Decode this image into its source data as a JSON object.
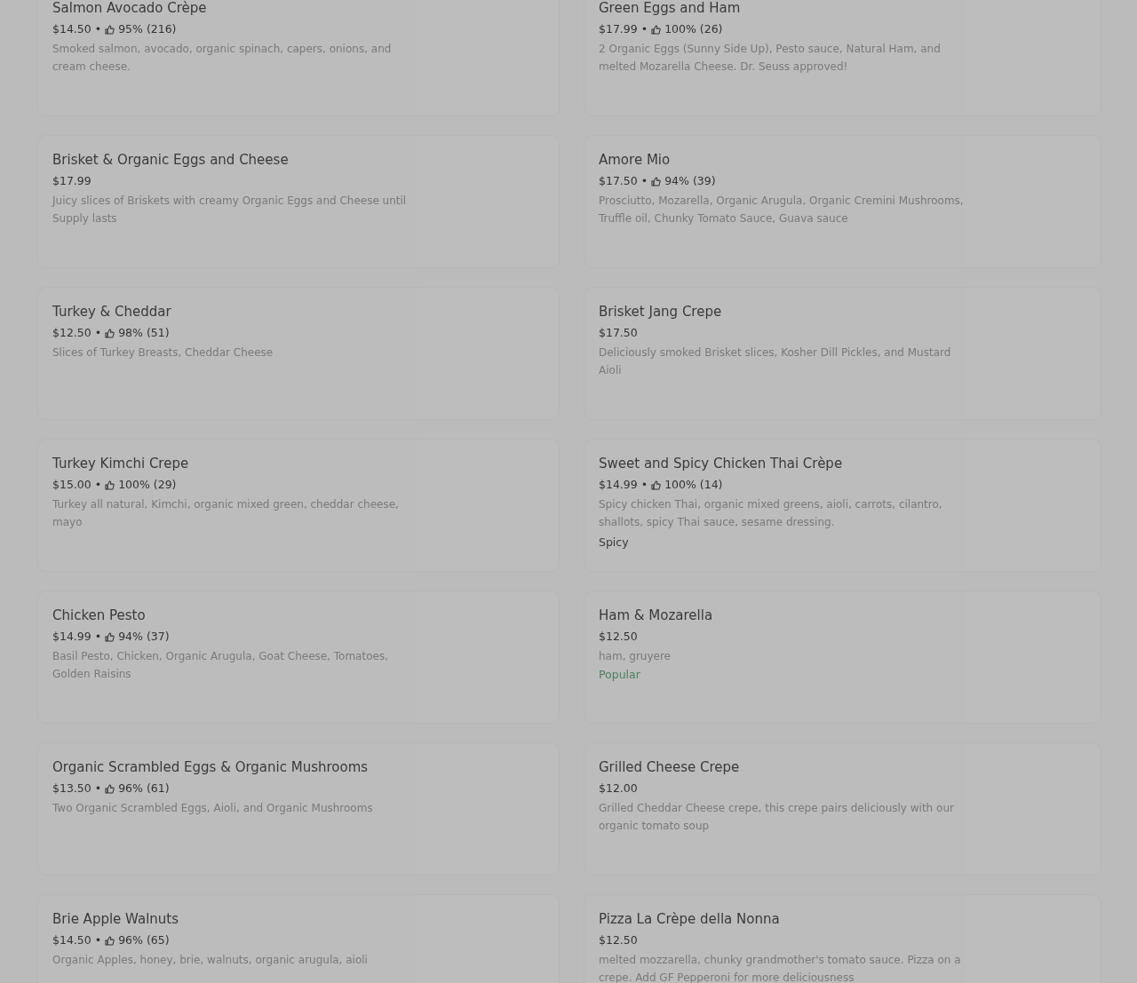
{
  "separator": "•",
  "items": [
    {
      "title": "Salmon Avocado Crèpe",
      "price": "$14.50",
      "rating": "95% (216)",
      "description": "Smoked salmon, avocado, organic spinach, capers, onions, and cream cheese."
    },
    {
      "title": "Green Eggs and Ham",
      "price": "$17.99",
      "rating": "100% (26)",
      "description": "2 Organic Eggs (Sunny Side Up), Pesto sauce, Natural Ham, and melted Mozarella Cheese. Dr. Seuss approved!"
    },
    {
      "title": "Brisket & Organic Eggs and Cheese",
      "price": "$17.99",
      "description": "Juicy slices of Briskets with creamy Organic Eggs and Cheese until Supply lasts"
    },
    {
      "title": "Amore Mio",
      "price": "$17.50",
      "rating": "94% (39)",
      "description": "Prosciutto, Mozarella, Organic Arugula, Organic Cremini Mushrooms, Truffle oil, Chunky Tomato Sauce, Guava sauce"
    },
    {
      "title": "Turkey & Cheddar",
      "price": "$12.50",
      "rating": "98% (51)",
      "description": "Slices of Turkey Breasts, Cheddar Cheese"
    },
    {
      "title": "Brisket Jang Crepe",
      "price": "$17.50",
      "description": "Deliciously smoked Brisket slices, Kosher Dill Pickles, and Mustard Aioli"
    },
    {
      "title": "Turkey Kimchi Crepe",
      "price": "$15.00",
      "rating": "100% (29)",
      "description": "Turkey all natural, Kimchi, organic mixed green, cheddar cheese, mayo"
    },
    {
      "title": "Sweet and Spicy Chicken Thai Crèpe",
      "price": "$14.99",
      "rating": "100% (14)",
      "description": "Spicy chicken Thai, organic mixed greens, aioli, carrots, cilantro, shallots, spicy Thai sauce, sesame dressing.",
      "tag": {
        "kind": "spicy",
        "text": "Spicy"
      }
    },
    {
      "title": "Chicken Pesto",
      "price": "$14.99",
      "rating": "94% (37)",
      "description": "Basil Pesto, Chicken, Organic Arugula, Goat Cheese, Tomatoes, Golden Raisins"
    },
    {
      "title": "Ham & Mozarella",
      "price": "$12.50",
      "description": "ham, gruyere",
      "tag": {
        "kind": "popular",
        "text": "Popular"
      }
    },
    {
      "title": "Organic Scrambled Eggs & Organic Mushrooms",
      "price": "$13.50",
      "rating": "96% (61)",
      "description": "Two Organic Scrambled Eggs, Aioli, and Organic Mushrooms"
    },
    {
      "title": "Grilled Cheese Crepe",
      "price": "$12.00",
      "description": "Grilled Cheddar Cheese crepe, this crepe pairs deliciously with our organic tomato soup"
    },
    {
      "title": "Brie Apple Walnuts",
      "price": "$14.50",
      "rating": "96% (65)",
      "description": "Organic Apples, honey, brie, walnuts, organic arugula, aioli"
    },
    {
      "title": "Pizza La Crèpe della Nonna",
      "price": "$12.50",
      "description": "melted mozzarella, chunky grandmother's tomato sauce. Pizza on a crepe. Add GF Pepperoni for more deliciousness"
    }
  ]
}
